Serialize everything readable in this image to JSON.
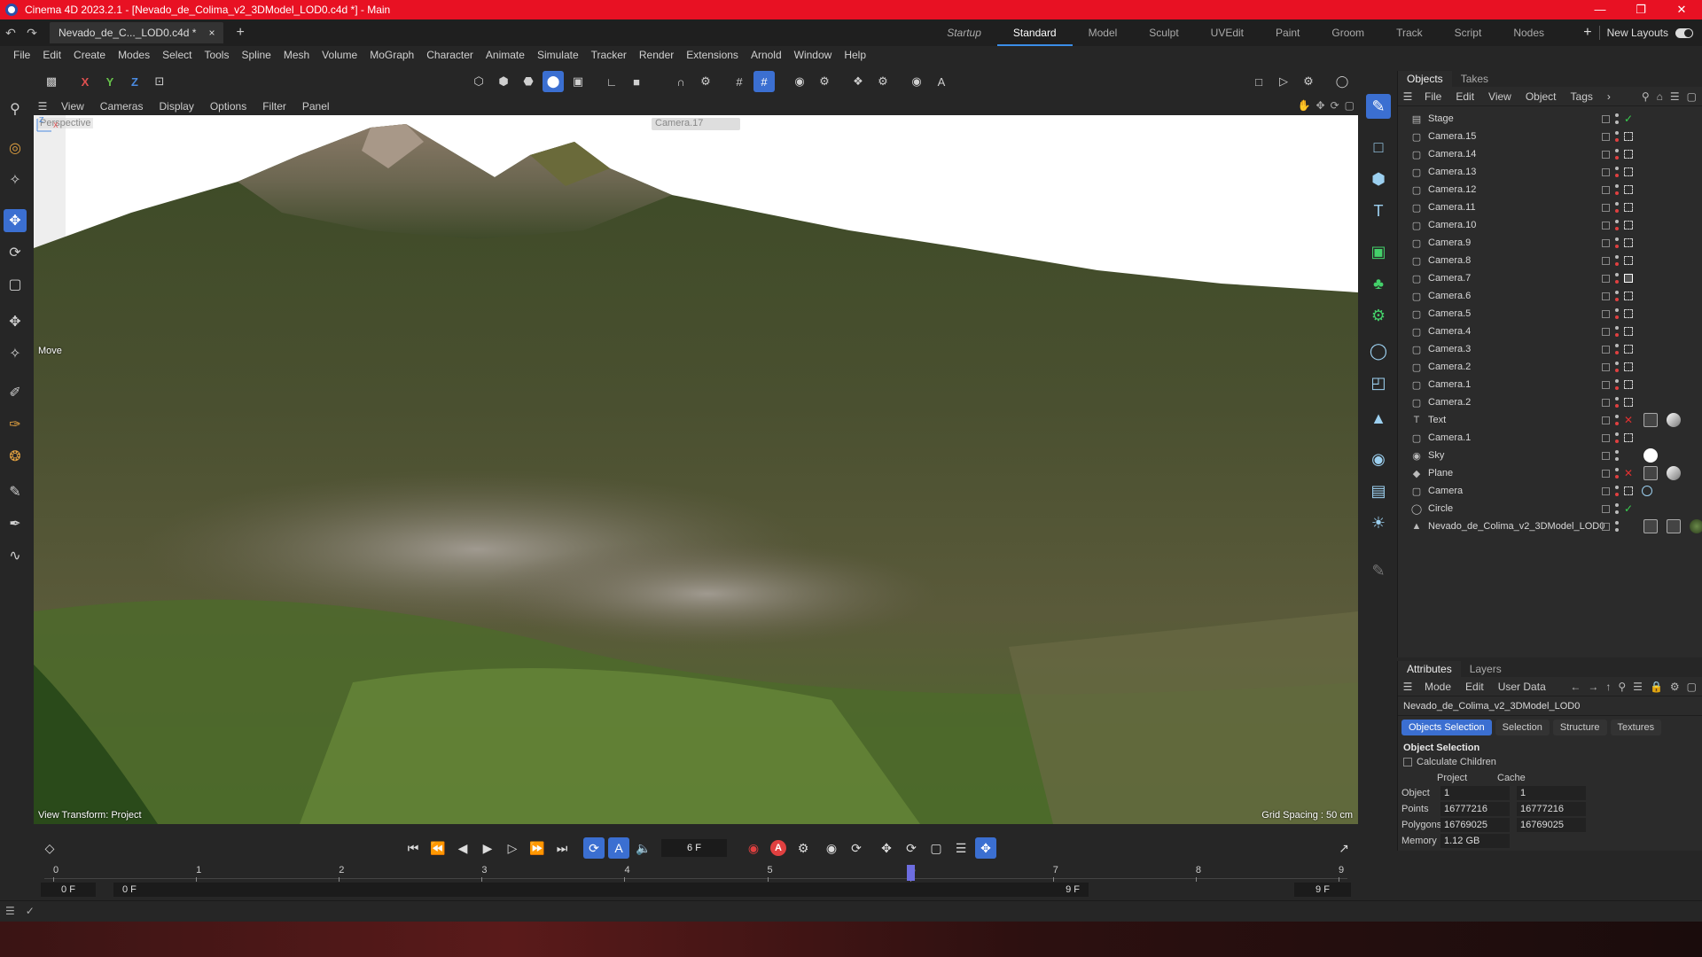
{
  "window": {
    "title": "Cinema 4D 2023.2.1 - [Nevado_de_Colima_v2_3DModel_LOD0.c4d *] - Main"
  },
  "doc_tab": {
    "label": "Nevado_de_C..._LOD0.c4d *",
    "close": "×"
  },
  "layouts": [
    "Startup",
    "Standard",
    "Model",
    "Sculpt",
    "UVEdit",
    "Paint",
    "Groom",
    "Track",
    "Script",
    "Nodes"
  ],
  "new_layouts": "New Layouts",
  "menu": [
    "File",
    "Edit",
    "Create",
    "Modes",
    "Select",
    "Tools",
    "Spline",
    "Mesh",
    "Volume",
    "MoGraph",
    "Character",
    "Animate",
    "Simulate",
    "Tracker",
    "Render",
    "Extensions",
    "Arnold",
    "Window",
    "Help"
  ],
  "axis_lock": {
    "x": "X",
    "y": "Y",
    "z": "Z"
  },
  "viewport_menu": [
    "View",
    "Cameras",
    "Display",
    "Options",
    "Filter",
    "Panel"
  ],
  "viewport": {
    "projection": "Perspective",
    "move_label": "Move",
    "view_transform": "View Transform: Project",
    "grid_spacing": "Grid Spacing : 50 cm",
    "camera_selector": "Camera.17"
  },
  "objects_panel": {
    "tabs": [
      "Objects",
      "Takes"
    ],
    "menu": [
      "File",
      "Edit",
      "View",
      "Object",
      "Tags"
    ],
    "items": [
      {
        "name": "Stage",
        "icon": "stage-icon"
      },
      {
        "name": "Camera.15",
        "icon": "camera-icon"
      },
      {
        "name": "Camera.14",
        "icon": "camera-icon"
      },
      {
        "name": "Camera.13",
        "icon": "camera-icon"
      },
      {
        "name": "Camera.12",
        "icon": "camera-icon"
      },
      {
        "name": "Camera.11",
        "icon": "camera-icon"
      },
      {
        "name": "Camera.10",
        "icon": "camera-icon"
      },
      {
        "name": "Camera.9",
        "icon": "camera-icon"
      },
      {
        "name": "Camera.8",
        "icon": "camera-icon"
      },
      {
        "name": "Camera.7",
        "icon": "camera-icon"
      },
      {
        "name": "Camera.6",
        "icon": "camera-icon"
      },
      {
        "name": "Camera.5",
        "icon": "camera-icon"
      },
      {
        "name": "Camera.4",
        "icon": "camera-icon"
      },
      {
        "name": "Camera.3",
        "icon": "camera-icon"
      },
      {
        "name": "Camera.2",
        "icon": "camera-icon"
      },
      {
        "name": "Camera.1",
        "icon": "camera-icon"
      },
      {
        "name": "Camera.2",
        "icon": "camera-icon"
      },
      {
        "name": "Text",
        "icon": "text-icon"
      },
      {
        "name": "Camera.1",
        "icon": "camera-icon"
      },
      {
        "name": "Sky",
        "icon": "sky-icon"
      },
      {
        "name": "Plane",
        "icon": "plane-icon"
      },
      {
        "name": "Camera",
        "icon": "camera-icon"
      },
      {
        "name": "Circle",
        "icon": "circle-icon"
      },
      {
        "name": "Nevado_de_Colima_v2_3DModel_LOD0",
        "icon": "polygon-object-icon"
      }
    ]
  },
  "attributes_panel": {
    "tabs": [
      "Attributes",
      "Layers"
    ],
    "menu": [
      "Mode",
      "Edit",
      "User Data"
    ],
    "object_name": "Nevado_de_Colima_v2_3DModel_LOD0",
    "subtabs": [
      "Objects Selection",
      "Selection",
      "Structure",
      "Textures"
    ],
    "section_title": "Object Selection",
    "calculate_children": "Calculate Children",
    "columns": [
      "Project",
      "Cache"
    ],
    "rows": [
      {
        "label": "Object",
        "project": "1",
        "cache": "1"
      },
      {
        "label": "Points",
        "project": "16777216",
        "cache": "16777216"
      },
      {
        "label": "Polygons",
        "project": "16769025",
        "cache": "16769025"
      },
      {
        "label": "Memory",
        "project": "1.12 GB",
        "cache": ""
      }
    ]
  },
  "timeline": {
    "current_frame": "6 F",
    "ticks": [
      "0",
      "1",
      "2",
      "3",
      "4",
      "5",
      "6",
      "7",
      "8",
      "9"
    ],
    "current_tick": 6,
    "start": "0 F",
    "range_start": "0 F",
    "range_end": "9 F",
    "end": "9 F"
  },
  "colors": {
    "accent": "#3b6fd1",
    "titlebar": "#e81123",
    "record": "#e04040",
    "ok_check": "#38d050"
  }
}
